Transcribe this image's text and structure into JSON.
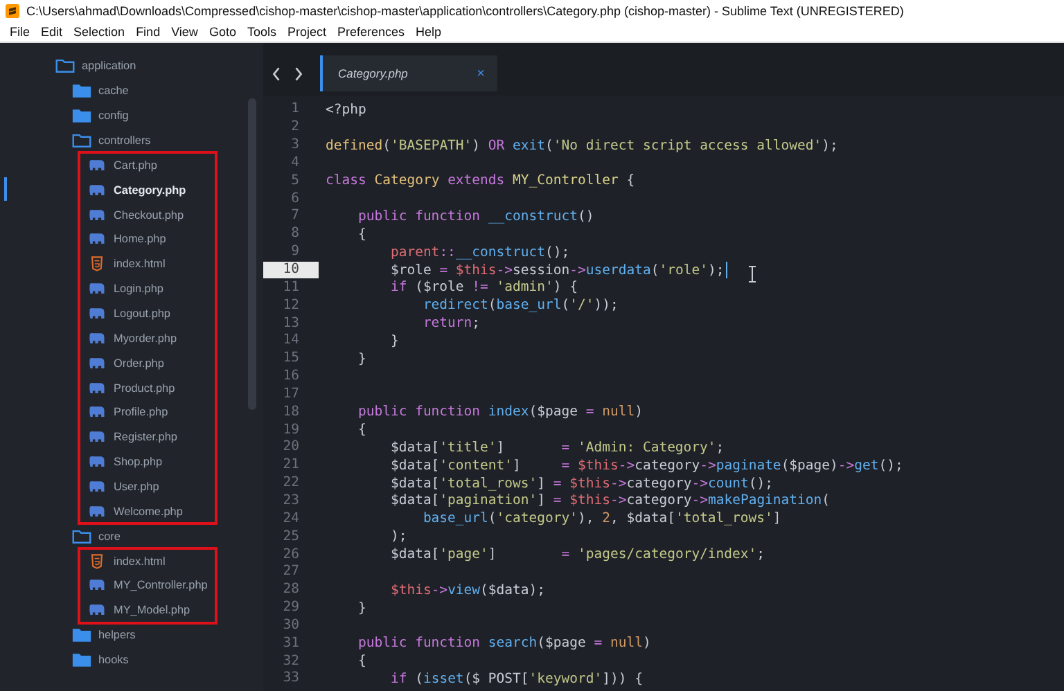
{
  "window": {
    "title": "C:\\Users\\ahmad\\Downloads\\Compressed\\cishop-master\\cishop-master\\application\\controllers\\Category.php (cishop-master) - Sublime Text (UNREGISTERED)"
  },
  "menu": [
    "File",
    "Edit",
    "Selection",
    "Find",
    "View",
    "Goto",
    "Tools",
    "Project",
    "Preferences",
    "Help"
  ],
  "sidebar": {
    "tree": [
      {
        "name": "application",
        "expanded": true,
        "children": [
          {
            "name": "cache",
            "expanded": false
          },
          {
            "name": "config",
            "expanded": false
          },
          {
            "name": "controllers",
            "expanded": true,
            "boxed": true,
            "children": [
              {
                "name": "Cart.php",
                "kind": "php",
                "selected": false
              },
              {
                "name": "Category.php",
                "kind": "php",
                "selected": true
              },
              {
                "name": "Checkout.php",
                "kind": "php",
                "selected": false
              },
              {
                "name": "Home.php",
                "kind": "php",
                "selected": false
              },
              {
                "name": "index.html",
                "kind": "html",
                "selected": false
              },
              {
                "name": "Login.php",
                "kind": "php",
                "selected": false
              },
              {
                "name": "Logout.php",
                "kind": "php",
                "selected": false
              },
              {
                "name": "Myorder.php",
                "kind": "php",
                "selected": false
              },
              {
                "name": "Order.php",
                "kind": "php",
                "selected": false
              },
              {
                "name": "Product.php",
                "kind": "php",
                "selected": false
              },
              {
                "name": "Profile.php",
                "kind": "php",
                "selected": false
              },
              {
                "name": "Register.php",
                "kind": "php",
                "selected": false
              },
              {
                "name": "Shop.php",
                "kind": "php",
                "selected": false
              },
              {
                "name": "User.php",
                "kind": "php",
                "selected": false
              },
              {
                "name": "Welcome.php",
                "kind": "php",
                "selected": false
              }
            ]
          },
          {
            "name": "core",
            "expanded": true,
            "boxed": true,
            "children": [
              {
                "name": "index.html",
                "kind": "html",
                "selected": false
              },
              {
                "name": "MY_Controller.php",
                "kind": "php",
                "selected": false
              },
              {
                "name": "MY_Model.php",
                "kind": "php",
                "selected": false
              }
            ]
          },
          {
            "name": "helpers",
            "expanded": false
          },
          {
            "name": "hooks",
            "expanded": false
          }
        ]
      }
    ]
  },
  "tabs": [
    {
      "label": "Category.php",
      "close": "×",
      "selected": true
    }
  ],
  "editor": {
    "lines": [
      {
        "number": "1",
        "current": false,
        "tokens": [
          {
            "text": "<?php",
            "kind": "plain"
          }
        ]
      },
      {
        "number": "2",
        "current": false
      },
      {
        "number": "3",
        "current": false,
        "tokens": [
          {
            "text": "defined",
            "kind": "cls"
          },
          {
            "text": "(",
            "kind": "plain"
          },
          {
            "text": "'BASEPATH'",
            "kind": "str"
          },
          {
            "text": ") ",
            "kind": "plain"
          },
          {
            "text": "OR",
            "kind": "kw"
          },
          {
            "text": " exit",
            "kind": "fn"
          },
          {
            "text": "(",
            "kind": "plain"
          },
          {
            "text": "'No direct script access allowed'",
            "kind": "str"
          },
          {
            "text": ");",
            "kind": "plain"
          }
        ]
      },
      {
        "number": "4",
        "current": false
      },
      {
        "number": "5",
        "current": false,
        "tokens": [
          {
            "text": "class",
            "kind": "kw"
          },
          {
            "text": " Category ",
            "kind": "cls"
          },
          {
            "text": "extends",
            "kind": "kw"
          },
          {
            "text": " MY_Controller",
            "kind": "type"
          },
          {
            "text": " {",
            "kind": "plain"
          }
        ]
      },
      {
        "number": "6",
        "current": false
      },
      {
        "number": "7",
        "current": false,
        "tokens": [
          {
            "text": "    public function",
            "kind": "kw"
          },
          {
            "text": " __construct",
            "kind": "fn"
          },
          {
            "text": "()",
            "kind": "plain"
          }
        ]
      },
      {
        "number": "8",
        "current": false,
        "tokens": [
          {
            "text": "    {",
            "kind": "plain"
          }
        ]
      },
      {
        "number": "9",
        "current": false,
        "tokens": [
          {
            "text": "        parent",
            "kind": "this"
          },
          {
            "text": "::",
            "kind": "op"
          },
          {
            "text": "__construct",
            "kind": "fn"
          },
          {
            "text": "();",
            "kind": "plain"
          }
        ]
      },
      {
        "number": "10",
        "current": true,
        "tokens": [
          {
            "text": "        $role ",
            "kind": "plain"
          },
          {
            "text": "=",
            "kind": "op"
          },
          {
            "text": " $this",
            "kind": "this"
          },
          {
            "text": "->",
            "kind": "op"
          },
          {
            "text": "session",
            "kind": "plain"
          },
          {
            "text": "->",
            "kind": "op"
          },
          {
            "text": "userdata",
            "kind": "fn"
          },
          {
            "text": "(",
            "kind": "plain"
          },
          {
            "text": "'role'",
            "kind": "str"
          },
          {
            "text": ");",
            "kind": "plain"
          }
        ]
      },
      {
        "number": "11",
        "current": false,
        "tokens": [
          {
            "text": "        if",
            "kind": "kw"
          },
          {
            "text": " ($role ",
            "kind": "plain"
          },
          {
            "text": "!=",
            "kind": "op"
          },
          {
            "text": " 'admin'",
            "kind": "str"
          },
          {
            "text": ") {",
            "kind": "plain"
          }
        ]
      },
      {
        "number": "12",
        "current": false,
        "tokens": [
          {
            "text": "            redirect",
            "kind": "fn"
          },
          {
            "text": "(",
            "kind": "plain"
          },
          {
            "text": "base_url",
            "kind": "fn"
          },
          {
            "text": "(",
            "kind": "plain"
          },
          {
            "text": "'/'",
            "kind": "str"
          },
          {
            "text": "));",
            "kind": "plain"
          }
        ]
      },
      {
        "number": "13",
        "current": false,
        "tokens": [
          {
            "text": "            return",
            "kind": "kw"
          },
          {
            "text": ";",
            "kind": "plain"
          }
        ]
      },
      {
        "number": "14",
        "current": false,
        "tokens": [
          {
            "text": "        }",
            "kind": "plain"
          }
        ]
      },
      {
        "number": "15",
        "current": false,
        "tokens": [
          {
            "text": "    }",
            "kind": "plain"
          }
        ]
      },
      {
        "number": "16",
        "current": false
      },
      {
        "number": "17",
        "current": false
      },
      {
        "number": "18",
        "current": false,
        "tokens": [
          {
            "text": "    public function",
            "kind": "kw"
          },
          {
            "text": " index",
            "kind": "fn"
          },
          {
            "text": "($page ",
            "kind": "plain"
          },
          {
            "text": "=",
            "kind": "op"
          },
          {
            "text": " null",
            "kind": "num"
          },
          {
            "text": ")",
            "kind": "plain"
          }
        ]
      },
      {
        "number": "19",
        "current": false,
        "tokens": [
          {
            "text": "    {",
            "kind": "plain"
          }
        ]
      },
      {
        "number": "20",
        "current": false,
        "tokens": [
          {
            "text": "        $data[",
            "kind": "plain"
          },
          {
            "text": "'title'",
            "kind": "str"
          },
          {
            "text": "]       ",
            "kind": "plain"
          },
          {
            "text": "=",
            "kind": "op"
          },
          {
            "text": " 'Admin: Category'",
            "kind": "str"
          },
          {
            "text": ";",
            "kind": "plain"
          }
        ]
      },
      {
        "number": "21",
        "current": false,
        "tokens": [
          {
            "text": "        $data[",
            "kind": "plain"
          },
          {
            "text": "'content'",
            "kind": "str"
          },
          {
            "text": "]     ",
            "kind": "plain"
          },
          {
            "text": "=",
            "kind": "op"
          },
          {
            "text": " $this",
            "kind": "this"
          },
          {
            "text": "->",
            "kind": "op"
          },
          {
            "text": "category",
            "kind": "plain"
          },
          {
            "text": "->",
            "kind": "op"
          },
          {
            "text": "paginate",
            "kind": "fn"
          },
          {
            "text": "($page)",
            "kind": "plain"
          },
          {
            "text": "->",
            "kind": "op"
          },
          {
            "text": "get",
            "kind": "fn"
          },
          {
            "text": "();",
            "kind": "plain"
          }
        ]
      },
      {
        "number": "22",
        "current": false,
        "tokens": [
          {
            "text": "        $data[",
            "kind": "plain"
          },
          {
            "text": "'total_rows'",
            "kind": "str"
          },
          {
            "text": "] ",
            "kind": "plain"
          },
          {
            "text": "=",
            "kind": "op"
          },
          {
            "text": " $this",
            "kind": "this"
          },
          {
            "text": "->",
            "kind": "op"
          },
          {
            "text": "category",
            "kind": "plain"
          },
          {
            "text": "->",
            "kind": "op"
          },
          {
            "text": "count",
            "kind": "fn"
          },
          {
            "text": "();",
            "kind": "plain"
          }
        ]
      },
      {
        "number": "23",
        "current": false,
        "tokens": [
          {
            "text": "        $data[",
            "kind": "plain"
          },
          {
            "text": "'pagination'",
            "kind": "str"
          },
          {
            "text": "] ",
            "kind": "plain"
          },
          {
            "text": "=",
            "kind": "op"
          },
          {
            "text": " $this",
            "kind": "this"
          },
          {
            "text": "->",
            "kind": "op"
          },
          {
            "text": "category",
            "kind": "plain"
          },
          {
            "text": "->",
            "kind": "op"
          },
          {
            "text": "makePagination",
            "kind": "fn"
          },
          {
            "text": "(",
            "kind": "plain"
          }
        ]
      },
      {
        "number": "24",
        "current": false,
        "tokens": [
          {
            "text": "            base_url",
            "kind": "fn"
          },
          {
            "text": "(",
            "kind": "plain"
          },
          {
            "text": "'category'",
            "kind": "str"
          },
          {
            "text": "), ",
            "kind": "plain"
          },
          {
            "text": "2",
            "kind": "num"
          },
          {
            "text": ", $data[",
            "kind": "plain"
          },
          {
            "text": "'total_rows'",
            "kind": "str"
          },
          {
            "text": "]",
            "kind": "plain"
          }
        ]
      },
      {
        "number": "25",
        "current": false,
        "tokens": [
          {
            "text": "        );",
            "kind": "plain"
          }
        ]
      },
      {
        "number": "26",
        "current": false,
        "tokens": [
          {
            "text": "        $data[",
            "kind": "plain"
          },
          {
            "text": "'page'",
            "kind": "str"
          },
          {
            "text": "]        ",
            "kind": "plain"
          },
          {
            "text": "=",
            "kind": "op"
          },
          {
            "text": " 'pages/category/index'",
            "kind": "str"
          },
          {
            "text": ";",
            "kind": "plain"
          }
        ]
      },
      {
        "number": "27",
        "current": false
      },
      {
        "number": "28",
        "current": false,
        "tokens": [
          {
            "text": "        $this",
            "kind": "this"
          },
          {
            "text": "->",
            "kind": "op"
          },
          {
            "text": "view",
            "kind": "fn"
          },
          {
            "text": "($data);",
            "kind": "plain"
          }
        ]
      },
      {
        "number": "29",
        "current": false,
        "tokens": [
          {
            "text": "    }",
            "kind": "plain"
          }
        ]
      },
      {
        "number": "30",
        "current": false
      },
      {
        "number": "31",
        "current": false,
        "tokens": [
          {
            "text": "    public function",
            "kind": "kw"
          },
          {
            "text": " search",
            "kind": "fn"
          },
          {
            "text": "($page ",
            "kind": "plain"
          },
          {
            "text": "=",
            "kind": "op"
          },
          {
            "text": " null",
            "kind": "num"
          },
          {
            "text": ")",
            "kind": "plain"
          }
        ]
      },
      {
        "number": "32",
        "current": false,
        "tokens": [
          {
            "text": "    {",
            "kind": "plain"
          }
        ]
      },
      {
        "number": "33",
        "current": false,
        "tokens": [
          {
            "text": "        if",
            "kind": "kw"
          },
          {
            "text": " (",
            "kind": "plain"
          },
          {
            "text": "isset",
            "kind": "fn"
          },
          {
            "text": "($ POST[",
            "kind": "plain"
          },
          {
            "text": "'keyword'",
            "kind": "str"
          },
          {
            "text": "])) {",
            "kind": "plain"
          }
        ]
      }
    ]
  }
}
